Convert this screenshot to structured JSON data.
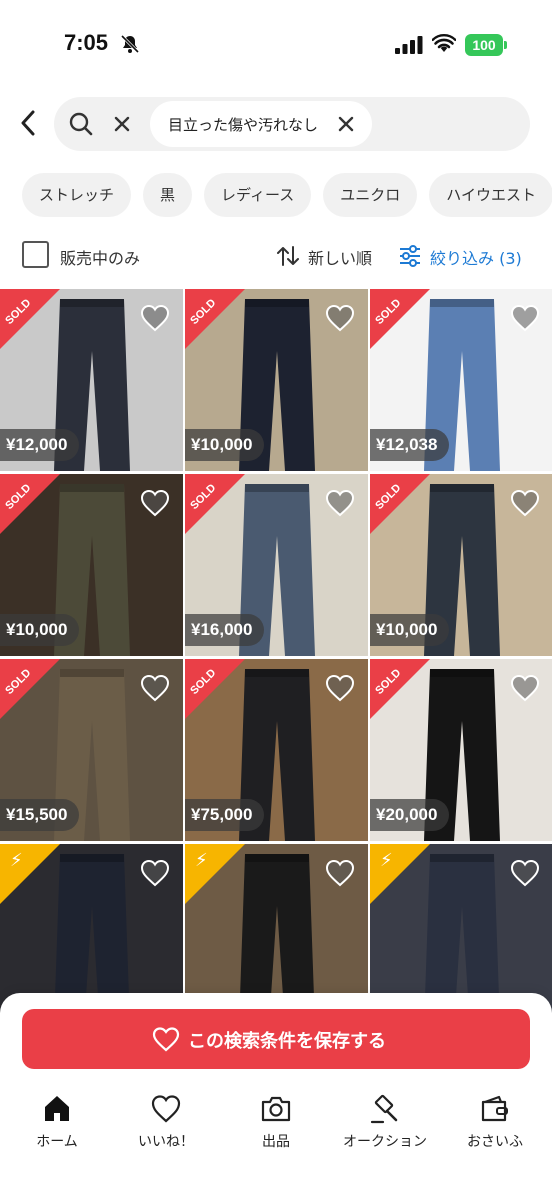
{
  "status": {
    "time": "7:05",
    "battery": "100"
  },
  "search": {
    "query_chip": "目立った傷や汚れなし"
  },
  "chips": [
    "ストレッチ",
    "黒",
    "レディース",
    "ユニクロ",
    "ハイウエスト"
  ],
  "toolbar": {
    "on_sale_only": "販売中のみ",
    "sort": "新しい順",
    "filter": "絞り込み (3)"
  },
  "badges": {
    "sold": "SOLD"
  },
  "items": [
    {
      "price": "¥12,000",
      "badge": "sold",
      "bg": "#c9c9c9",
      "jean": "#2b2f3a"
    },
    {
      "price": "¥10,000",
      "badge": "sold",
      "bg": "#b7a98f",
      "jean": "#1d2230"
    },
    {
      "price": "¥12,038",
      "badge": "sold",
      "bg": "#f3f3f3",
      "jean": "#5b7fb3"
    },
    {
      "price": "¥10,000",
      "badge": "sold",
      "bg": "#3b3026",
      "jean": "#4c4a38"
    },
    {
      "price": "¥16,000",
      "badge": "sold",
      "bg": "#d9d4c8",
      "jean": "#4a5a70"
    },
    {
      "price": "¥10,000",
      "badge": "sold",
      "bg": "#c7b69a",
      "jean": "#2d3540"
    },
    {
      "price": "¥15,500",
      "badge": "sold",
      "bg": "#5e5242",
      "jean": "#6b5d48"
    },
    {
      "price": "¥75,000",
      "badge": "sold",
      "bg": "#8a6a48",
      "jean": "#1f1f22"
    },
    {
      "price": "¥20,000",
      "badge": "sold",
      "bg": "#e6e2dc",
      "jean": "#151515"
    },
    {
      "price": "",
      "badge": "flash",
      "bg": "#2b2b30",
      "jean": "#1e2330"
    },
    {
      "price": "",
      "badge": "flash",
      "bg": "#6e5b45",
      "jean": "#1a1a1a"
    },
    {
      "price": "",
      "badge": "flash",
      "bg": "#3a3d48",
      "jean": "#2a3040"
    }
  ],
  "save_button": "この検索条件を保存する",
  "nav": [
    "ホーム",
    "いいね！",
    "出品",
    "オークション",
    "おさいふ"
  ]
}
